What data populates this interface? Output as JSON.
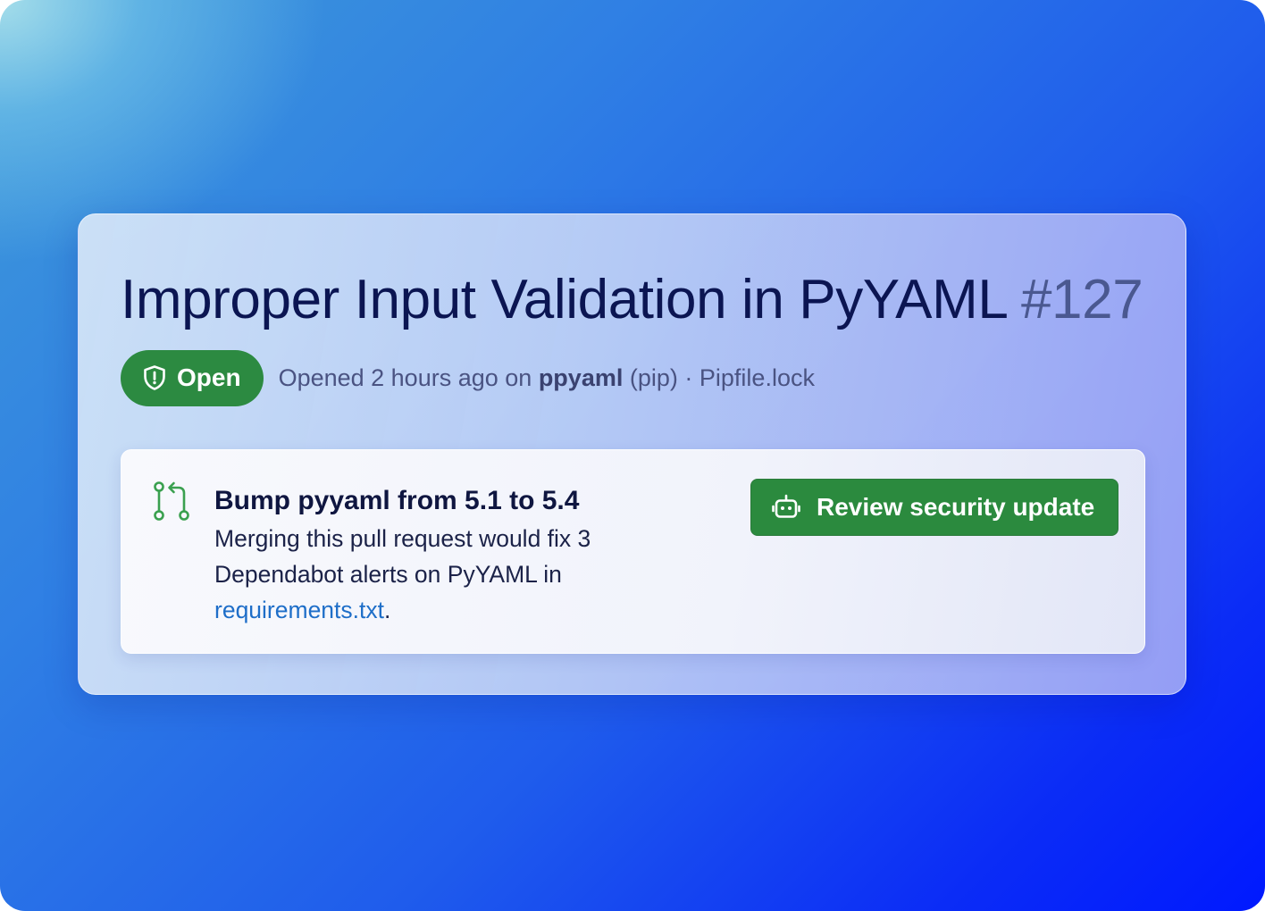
{
  "alert": {
    "title": "Improper Input Validation in PyYAML",
    "number": "#127",
    "status": {
      "label": "Open",
      "icon": "shield-icon",
      "color": "#2c8a41"
    },
    "meta": {
      "opened_prefix": "Opened 2 hours ago on",
      "package": "ppyaml",
      "ecosystem": "(pip)",
      "separator": "·",
      "manifest": "Pipfile.lock"
    }
  },
  "pull_request": {
    "icon": "git-pull-request-icon",
    "title": "Bump pyyaml from 5.1 to 5.4",
    "description": "Merging this pull request would fix 3 Dependabot alerts on PyYAML in",
    "link_text": "requirements.txt",
    "trailing": ".",
    "link_color": "#1e6ec8",
    "action": {
      "label": "Review security update",
      "icon": "copilot-bot-icon",
      "color": "#2b8a3e"
    }
  }
}
